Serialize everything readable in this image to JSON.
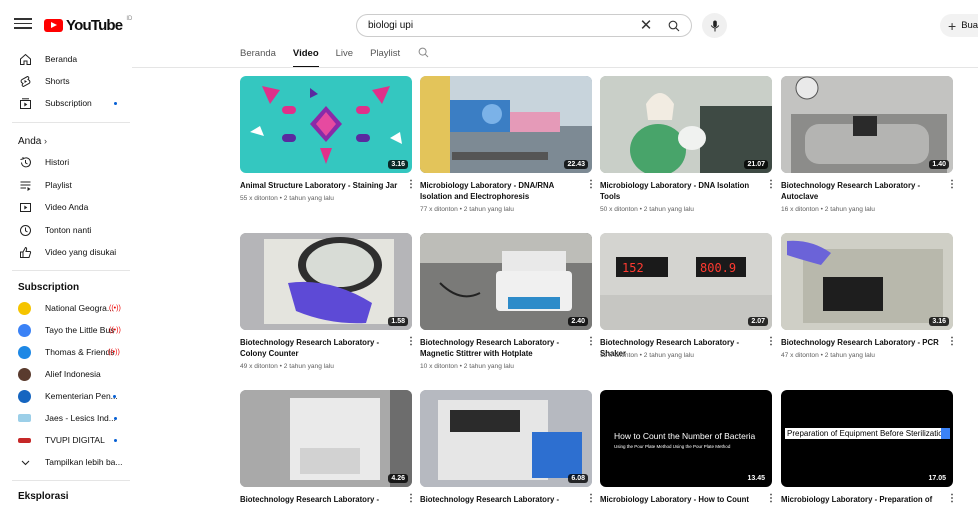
{
  "header": {
    "logo_text": "YouTube",
    "logo_region": "ID",
    "search_value": "biologi upi",
    "create_label": "Buat"
  },
  "sidebar": {
    "main": [
      {
        "label": "Beranda",
        "icon": "home-icon"
      },
      {
        "label": "Shorts",
        "icon": "shorts-icon"
      },
      {
        "label": "Subscription",
        "icon": "subscriptions-icon"
      }
    ],
    "you_heading": "Anda",
    "you": [
      {
        "label": "Histori",
        "icon": "history-icon"
      },
      {
        "label": "Playlist",
        "icon": "playlist-icon"
      },
      {
        "label": "Video Anda",
        "icon": "your-videos-icon"
      },
      {
        "label": "Tonton nanti",
        "icon": "watch-later-icon"
      },
      {
        "label": "Video yang disukai",
        "icon": "liked-icon"
      }
    ],
    "subs_heading": "Subscription",
    "subs": [
      {
        "label": "National Geogra...",
        "badge": "live",
        "color": "#f5c400"
      },
      {
        "label": "Tayo the Little Bus",
        "badge": "live",
        "color": "#3b82f6"
      },
      {
        "label": "Thomas & Friends",
        "badge": "live",
        "color": "#1e88e5"
      },
      {
        "label": "Alief Indonesia",
        "badge": "none",
        "color": "#5a3b2e"
      },
      {
        "label": "Kementerian Pen...",
        "badge": "dot",
        "color": "#1565c0"
      },
      {
        "label": "Jaes - Lesics Ind...",
        "badge": "dot",
        "color": "#9ccfe8"
      },
      {
        "label": "TVUPI DIGITAL",
        "badge": "dot",
        "color": "#c62828"
      }
    ],
    "show_more": "Tampilkan lebih ba...",
    "explore_heading": "Eksplorasi"
  },
  "tabs": [
    "Beranda",
    "Video",
    "Live",
    "Playlist"
  ],
  "active_tab": "Video",
  "videos": [
    {
      "title": "Animal Structure Laboratory - Staining Jar",
      "meta": "55 x ditonton • 2 tahun yang lalu",
      "duration": "3.16",
      "bg": "#34c7c0"
    },
    {
      "title": "Microbiology Laboratory - DNA/RNA Isolation and Electrophoresis",
      "meta": "77 x ditonton • 2 tahun yang lalu",
      "duration": "22.43",
      "bg": "#6a8aa0"
    },
    {
      "title": "Microbiology Laboratory - DNA Isolation Tools",
      "meta": "50 x ditonton • 2 tahun yang lalu",
      "duration": "21.07",
      "bg": "#9aa29a"
    },
    {
      "title": "Biotechnology Research Laboratory - Autoclave",
      "meta": "16 x ditonton • 2 tahun yang lalu",
      "duration": "1.40",
      "bg": "#9c9c9c"
    },
    {
      "title": "Biotechnology Research Laboratory - Colony Counter",
      "meta": "49 x ditonton • 2 tahun yang lalu",
      "duration": "1.58",
      "bg": "#8e8e92"
    },
    {
      "title": "Biotechnology Research Laboratory - Magnetic Stittrer with Hotplate",
      "meta": "10 x ditonton • 2 tahun yang lalu",
      "duration": "2.40",
      "bg": "#6b6b6b"
    },
    {
      "title": "Biotechnology Research Laboratory - Shaker",
      "meta": "12 x ditonton • 2 tahun yang lalu",
      "duration": "2.07",
      "bg": "#b9b9b5"
    },
    {
      "title": "Biotechnology Research Laboratory - PCR",
      "meta": "47 x ditonton • 2 tahun yang lalu",
      "duration": "3.16",
      "bg": "#b0b0a4"
    },
    {
      "title": "Biotechnology Research Laboratory -",
      "meta": "",
      "duration": "4.26",
      "bg": "#8d8d8d"
    },
    {
      "title": "Biotechnology Research Laboratory -",
      "meta": "",
      "duration": "6.08",
      "bg": "#9a9ea8"
    },
    {
      "title": "Microbiology Laboratory - How to Count",
      "meta": "",
      "duration": "13.45",
      "bg": "#000000",
      "caption": "How to Count the Number of Bacteria",
      "caption_sub": "Using the Pour Plate Method Using the Pour Plate Method"
    },
    {
      "title": "Microbiology Laboratory - Preparation of",
      "meta": "",
      "duration": "17.05",
      "bg": "#000000",
      "caption": "Preparation of Equipment Before Sterilization"
    }
  ]
}
